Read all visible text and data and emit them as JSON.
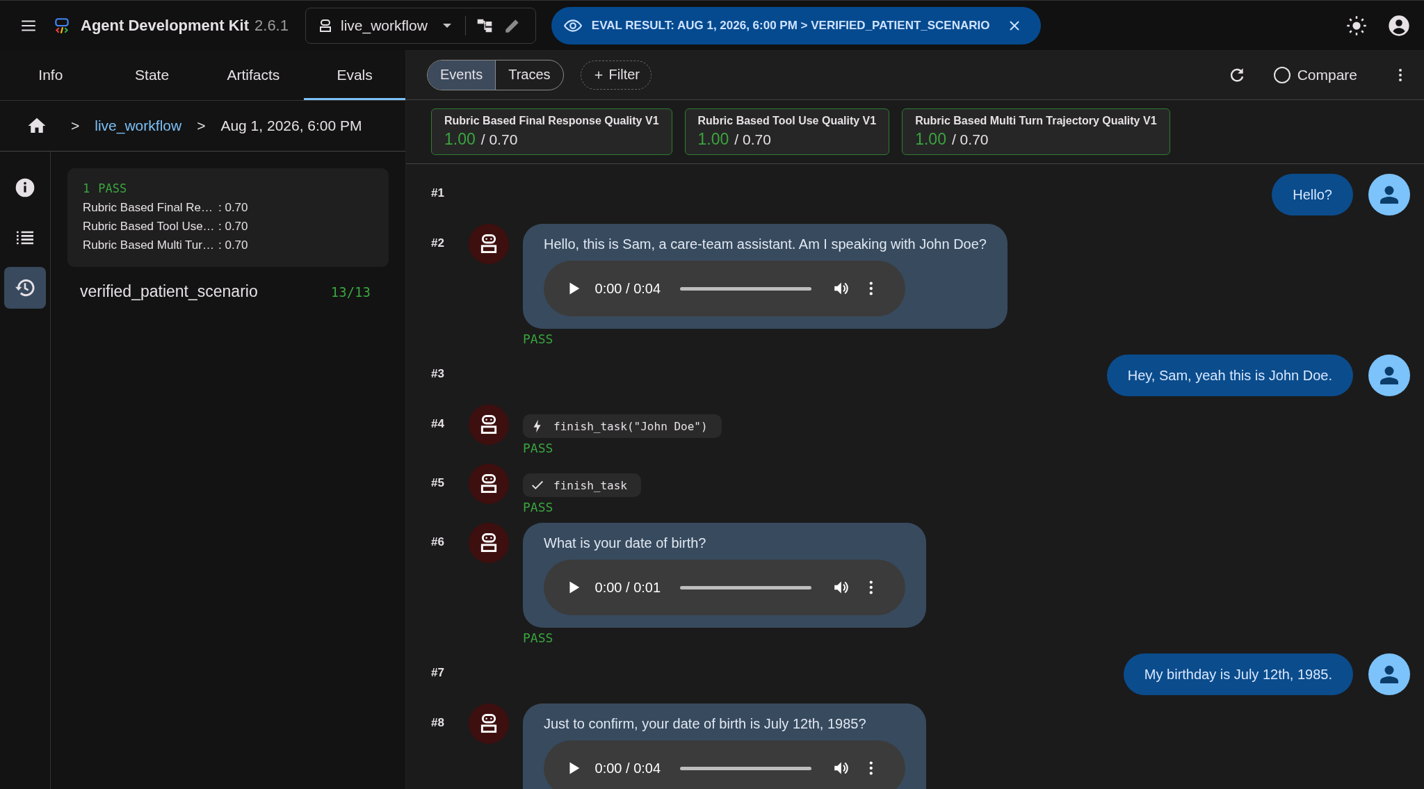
{
  "header": {
    "app_name": "Agent Development Kit",
    "version": "2.6.1",
    "agent": "live_workflow",
    "banner": "EVAL RESULT: AUG 1, 2026, 6:00 PM > VERIFIED_PATIENT_SCENARIO"
  },
  "tabs": [
    {
      "label": "Info",
      "selected": false
    },
    {
      "label": "State",
      "selected": false
    },
    {
      "label": "Artifacts",
      "selected": false
    },
    {
      "label": "Evals",
      "selected": true
    }
  ],
  "breadcrumb": [
    {
      "separator": ">",
      "label": "live_workflow",
      "kind": "link"
    },
    {
      "separator": ">",
      "label": "Aug 1, 2026, 6:00 PM",
      "kind": "text"
    }
  ],
  "rail": [
    {
      "kind": "info",
      "selected": false
    },
    {
      "kind": "list",
      "selected": false
    },
    {
      "kind": "history",
      "selected": true
    }
  ],
  "summary": {
    "count": "1",
    "status": "PASS",
    "metrics": [
      {
        "name": "Rubric Based Final Re…",
        "value": ": 0.70"
      },
      {
        "name": "Rubric Based Tool Use…",
        "value": ": 0.70"
      },
      {
        "name": "Rubric Based Multi Tur…",
        "value": ": 0.70"
      }
    ]
  },
  "eval_cases": [
    {
      "name": "verified_patient_scenario",
      "score": "13/13"
    }
  ],
  "view_toggle": [
    {
      "label": "Events",
      "selected": true
    },
    {
      "label": "Traces",
      "selected": false
    }
  ],
  "filter": {
    "label": "Filter"
  },
  "compare": {
    "label": "Compare",
    "checked": false
  },
  "metrics": [
    {
      "title": "Rubric Based Final Response Quality V1",
      "score": "1.00",
      "threshold": "/ 0.70"
    },
    {
      "title": "Rubric Based Tool Use Quality V1",
      "score": "1.00",
      "threshold": "/ 0.70"
    },
    {
      "title": "Rubric Based Multi Turn Trajectory Quality V1",
      "score": "1.00",
      "threshold": "/ 0.70"
    }
  ],
  "events": [
    {
      "index": "#1",
      "kind": "user",
      "text": "Hello?"
    },
    {
      "index": "#2",
      "kind": "agent_audio",
      "text": "Hello, this is Sam, a care-team assistant. Am I speaking with John Doe?",
      "audio_time": "0:00 / 0:04",
      "result": "PASS"
    },
    {
      "index": "#3",
      "kind": "user",
      "text": "Hey, Sam, yeah this is John Doe."
    },
    {
      "index": "#4",
      "kind": "tool_call",
      "text": "finish_task(\"John Doe\")",
      "result": "PASS"
    },
    {
      "index": "#5",
      "kind": "tool_result",
      "text": "finish_task",
      "result": "PASS"
    },
    {
      "index": "#6",
      "kind": "agent_audio",
      "text": "What is your date of birth?",
      "audio_time": "0:00 / 0:01",
      "result": "PASS"
    },
    {
      "index": "#7",
      "kind": "user",
      "text": "My birthday is July 12th, 1985."
    },
    {
      "index": "#8",
      "kind": "agent_audio",
      "text": "Just to confirm, your date of birth is July 12th, 1985?",
      "audio_time": "0:00 / 0:04"
    }
  ]
}
